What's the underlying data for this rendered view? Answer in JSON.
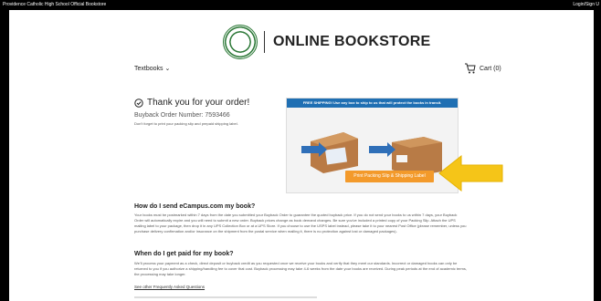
{
  "topbar": {
    "school": "Providence Catholic High School Official Bookstore",
    "login": "Login/Sign U"
  },
  "brand": {
    "title": "ONLINE BOOKSTORE",
    "seal_color": "#2f7a3a"
  },
  "nav": {
    "textbooks_label": "Textbooks",
    "textbooks_icon": "chevron-down-icon",
    "cart_label": "Cart (0)",
    "cart_icon": "shopping-cart-icon"
  },
  "confirmation": {
    "title": "Thank you for your order!",
    "order_number": "Buyback Order Number: 7593466",
    "note": "Don't forget to print your packing slip and prepaid shipping label."
  },
  "promo": {
    "banner": "FREE SHIPPING! Use any box to ship to us that will protect the books in transit.",
    "button": "Print Packing Slip & Shipping Label",
    "banner_color": "#1f6fb3",
    "button_color": "#f39a2b",
    "callout_color": "#f5c518"
  },
  "faq": {
    "q1_title": "How do I send eCampus.com my book?",
    "q1_body": "Your books must be postmarked within 7 days from the date you submitted your Buyback Order to guarantee the quoted buyback price. If you do not send your books to us within 7 days, your Buyback Order will automatically expire and you will need to submit a new order. Buyback prices change as book demand changes. Be sure you've included a printed copy of your Packing Slip. Attach the UPS mailing label to your package, then drop it in any UPS Collection Box or at a UPS Store. If you choose to use the USPS label instead, please take it to your nearest Post Office (please remember, unless you purchase delivery confirmation and/or insurance on the shipment from the postal service when mailing it, there is no protection against lost or damaged packages).",
    "q2_title": "When do I get paid for my book?",
    "q2_body": "We'll process your payment as a check, direct deposit or buyback credit as you requested once we receive your books and verify that they meet our standards. Incorrect or damaged books can only be returned to you if you authorize a shipping/handling fee to cover that cost. Buyback processing may take 4-6 weeks from the date your books are received. During peak periods at the end of academic terms, the processing may take longer.",
    "link": "See other Frequently Asked Questions"
  }
}
